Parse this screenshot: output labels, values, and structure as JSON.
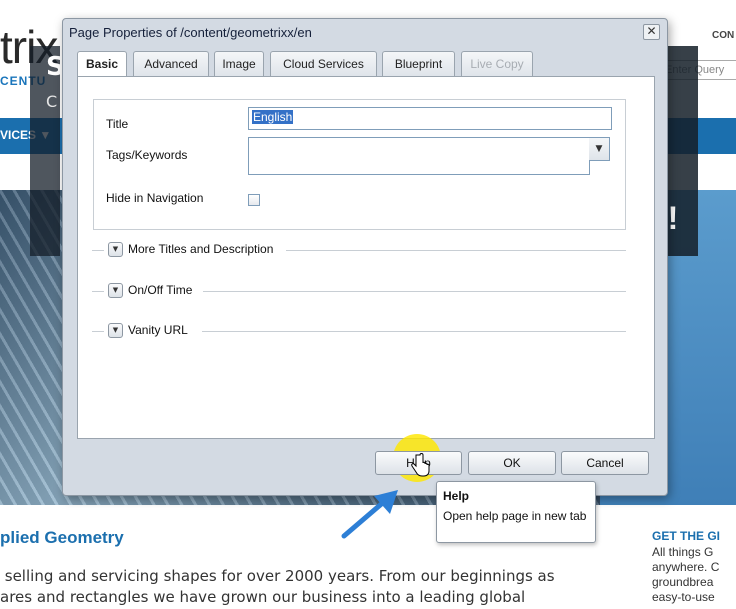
{
  "site": {
    "logo_text": "trix",
    "logo_sub": "CENTU",
    "top_link": "CON",
    "search_placeholder": "Enter Query",
    "nav_item": "VICES ▼",
    "hero_big": "S",
    "hero_small": "C",
    "hero_excl": "t!",
    "section_heading": "plied Geometry",
    "section_body_1": " selling and servicing shapes for over 2000 years. From our beginnings as",
    "section_body_2": "ares and rectangles we have grown our business into a leading global",
    "side_heading": "GET THE GI",
    "side_lines": [
      "All things G",
      "anywhere. C",
      "groundbrea",
      "easy-to-use"
    ]
  },
  "dialog": {
    "title": "Page Properties of /content/geometrixx/en",
    "close_label": "✕",
    "tabs": [
      {
        "label": "Basic"
      },
      {
        "label": "Advanced"
      },
      {
        "label": "Image"
      },
      {
        "label": "Cloud Services"
      },
      {
        "label": "Blueprint"
      },
      {
        "label": "Live Copy"
      }
    ],
    "active_tab": "Basic",
    "disabled_tab": "Live Copy",
    "fields": {
      "title_label": "Title",
      "title_value": "English",
      "tags_label": "Tags/Keywords",
      "tags_value": "",
      "hide_label": "Hide in Navigation",
      "hide_checked": false
    },
    "sections": [
      {
        "label": "More Titles and Description"
      },
      {
        "label": "On/Off Time"
      },
      {
        "label": "Vanity URL"
      }
    ],
    "buttons": {
      "help": "Help",
      "ok": "OK",
      "cancel": "Cancel"
    }
  },
  "tooltip": {
    "title": "Help",
    "body": "Open help page in new tab"
  },
  "colors": {
    "dialog_bg": "#d3dae3",
    "site_blue": "#1b6fae",
    "highlight": "#ffe600",
    "arrow": "#2d7fd6"
  }
}
